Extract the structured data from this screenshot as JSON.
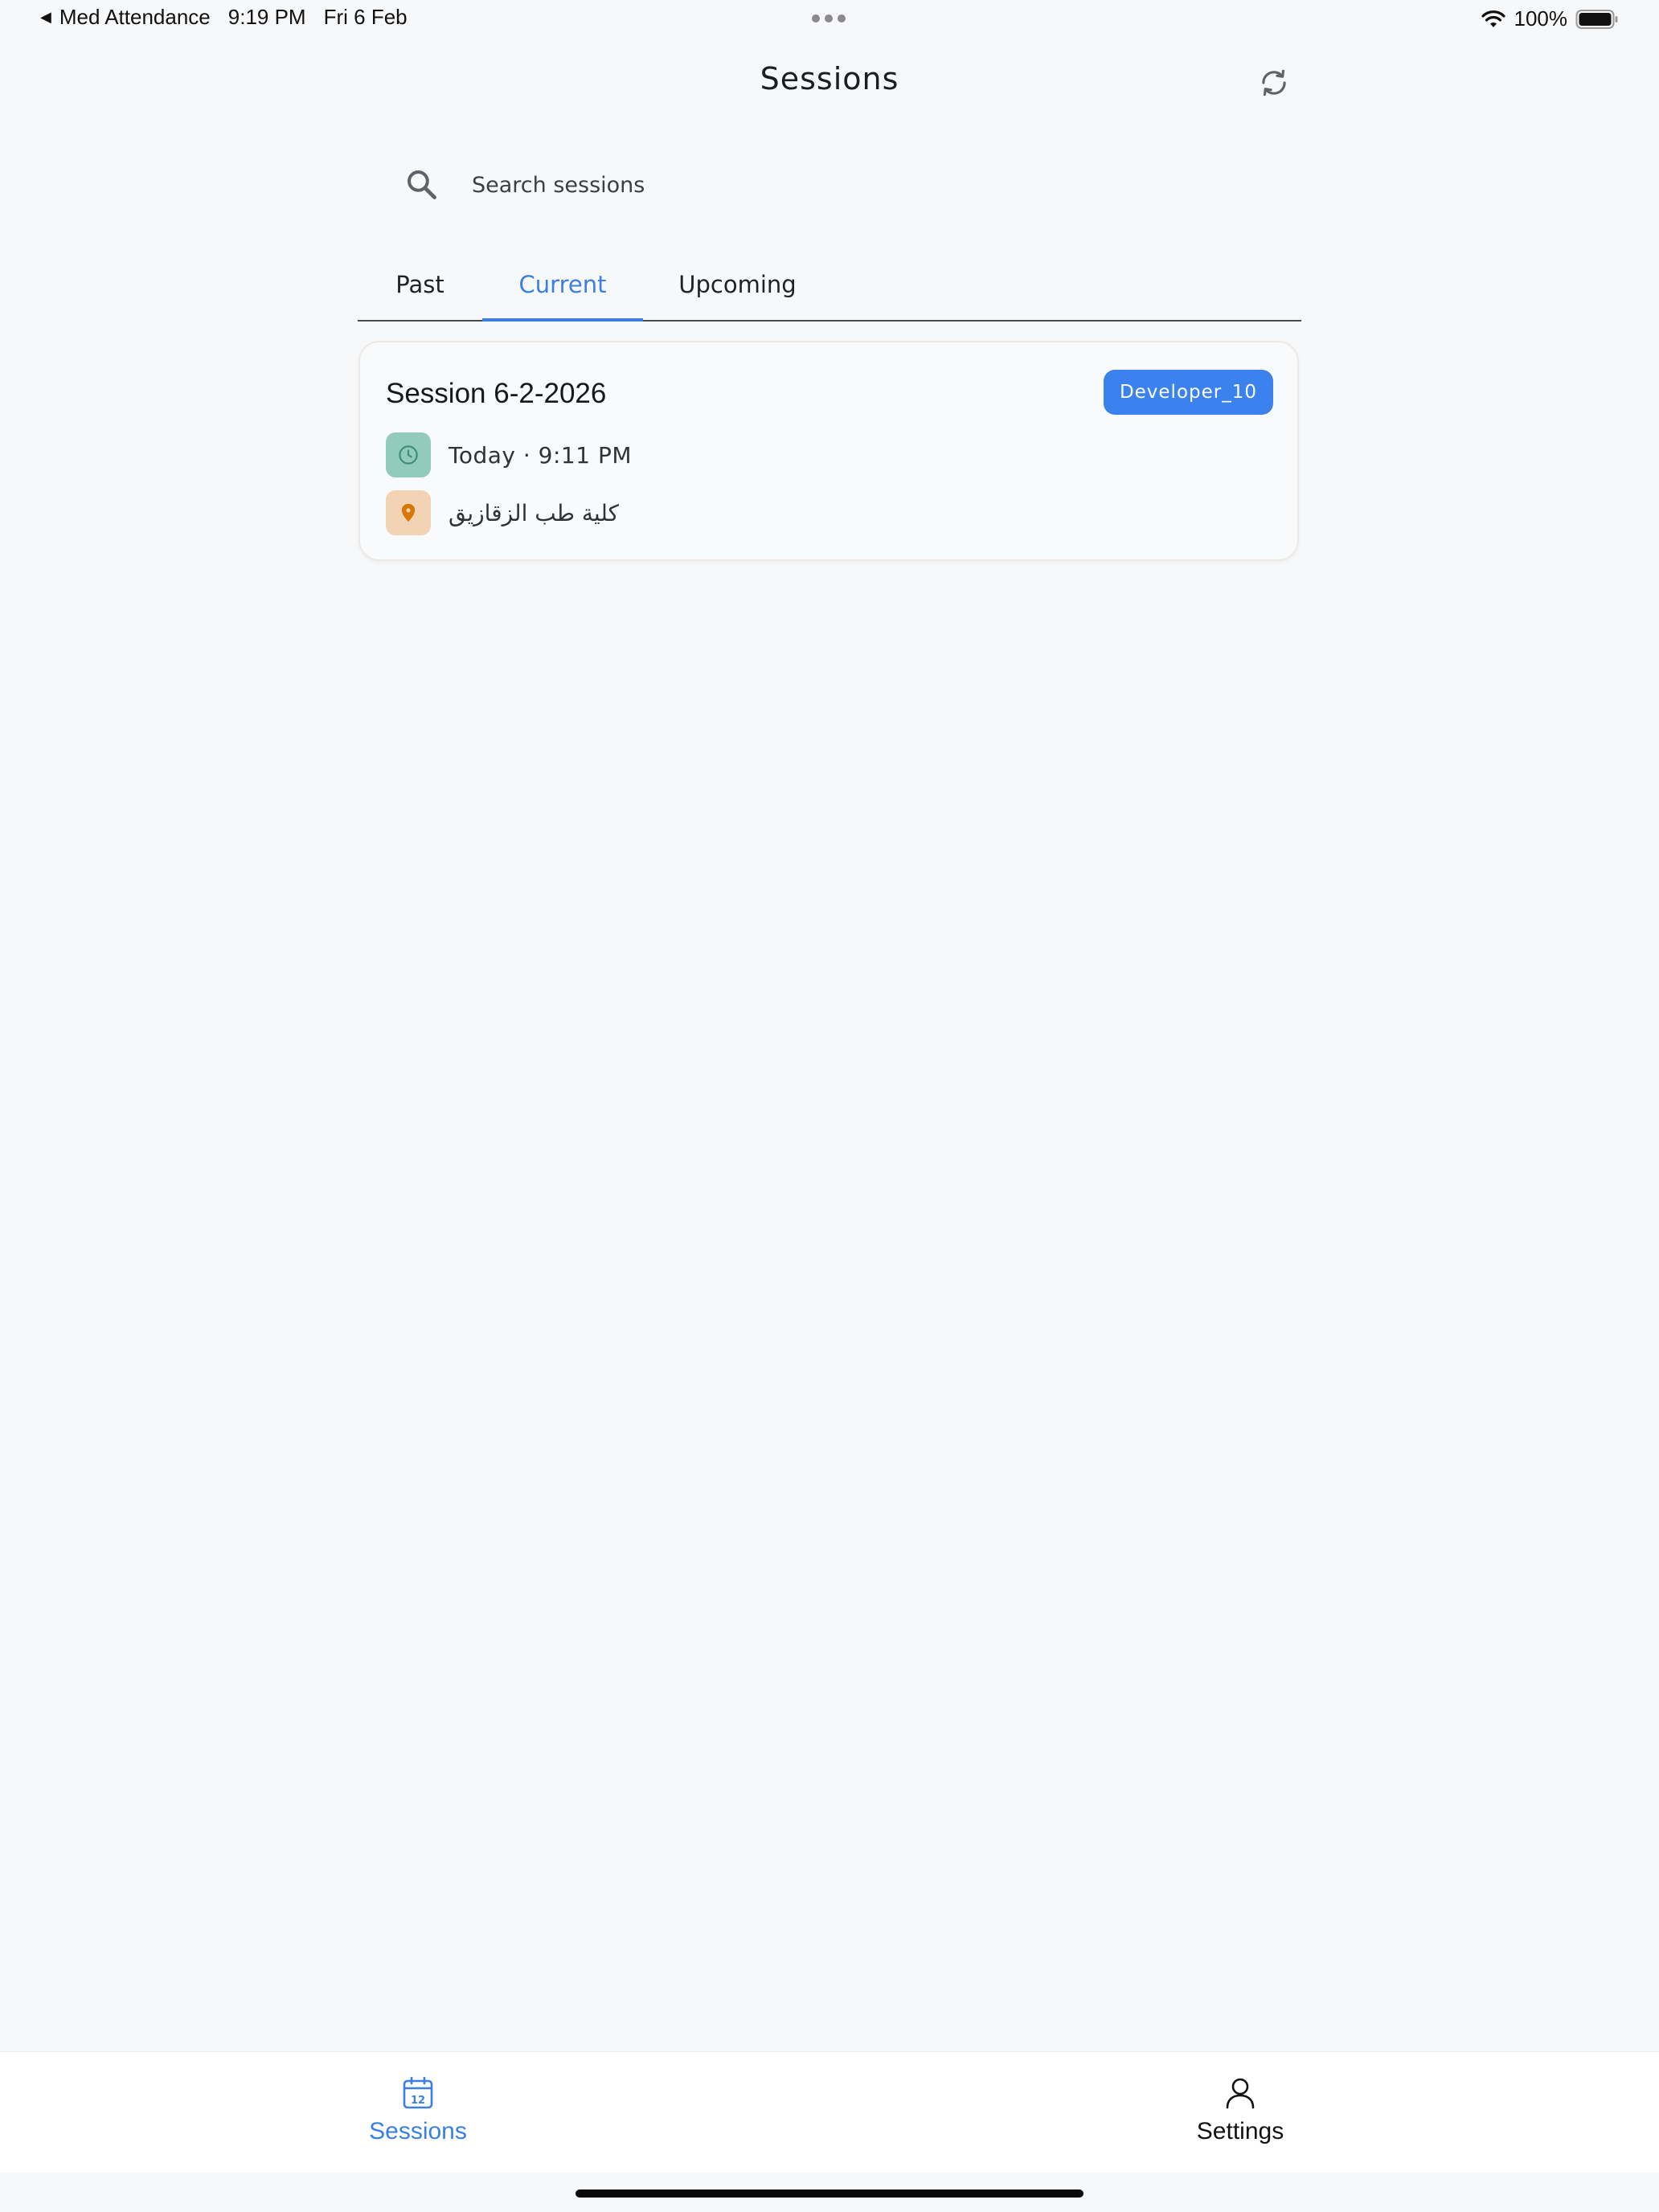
{
  "status_bar": {
    "back_app": "Med Attendance",
    "time": "9:19 PM",
    "date": "Fri 6 Feb",
    "battery": "100%"
  },
  "header": {
    "title": "Sessions",
    "refresh_icon": "refresh-icon"
  },
  "search": {
    "placeholder": "Search sessions",
    "value": "",
    "icon": "search-icon"
  },
  "tabs": [
    {
      "label": "Past",
      "active": false
    },
    {
      "label": "Current",
      "active": true
    },
    {
      "label": "Upcoming",
      "active": false
    }
  ],
  "sessions": [
    {
      "title": "Session 6-2-2026",
      "badge": "Developer_10",
      "time": "Today · 9:11 PM",
      "location": "كلية طب الزقازيق"
    }
  ],
  "bottom_nav": [
    {
      "label": "Sessions",
      "icon": "calendar-icon",
      "icon_text": "12",
      "active": true
    },
    {
      "label": "Settings",
      "icon": "person-icon",
      "active": false
    }
  ],
  "colors": {
    "accent": "#3b7fe0",
    "badge": "#3b82ee",
    "background": "#f7f8fa",
    "clock_bg": "#93cbbb",
    "pin_bg": "#f2d4b5",
    "pin": "#d97706"
  }
}
